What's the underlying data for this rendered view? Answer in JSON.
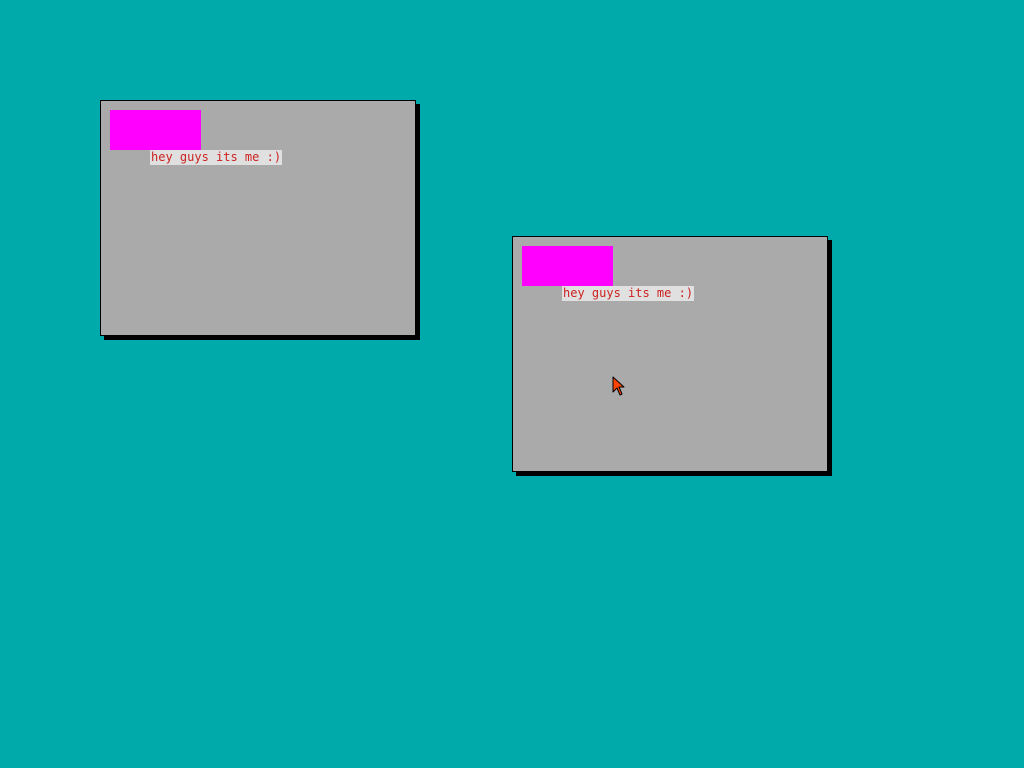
{
  "desktop": {
    "background_color": "#00aaaa"
  },
  "windows": [
    {
      "background_color": "#aaaaaa",
      "swatch_color": "#ff00ff",
      "label": "hey guys its me :)",
      "label_color": "#cc2222",
      "label_background": "#e0e0e0"
    },
    {
      "background_color": "#aaaaaa",
      "swatch_color": "#ff00ff",
      "label": "hey guys its me :)",
      "label_color": "#cc2222",
      "label_background": "#e0e0e0"
    }
  ],
  "cursor": {
    "icon": "arrow-cursor-icon",
    "fill_color": "#ff4400",
    "outline_color": "#000000"
  }
}
